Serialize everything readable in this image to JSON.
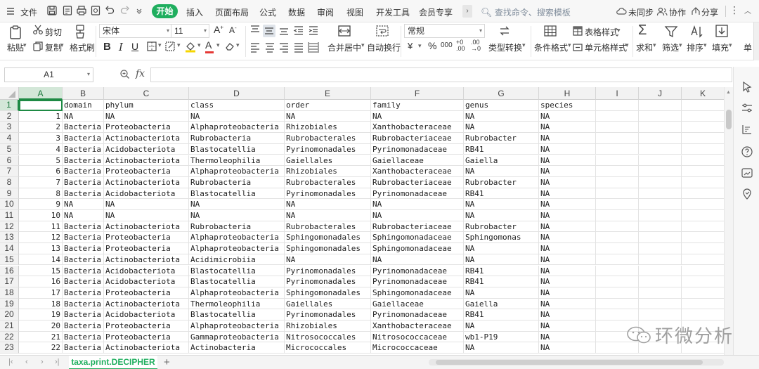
{
  "menubar": {
    "file_label": "文件",
    "tabs": [
      "开始",
      "插入",
      "页面布局",
      "公式",
      "数据",
      "审阅",
      "视图",
      "开发工具",
      "会员专享"
    ],
    "search_placeholder": "查找命令、搜索模板",
    "sync_label": "未同步",
    "collab_label": "协作",
    "share_label": "分享"
  },
  "ribbon": {
    "paste_label": "粘贴",
    "cut_label": "剪切",
    "copy_label": "复制",
    "format_painter_label": "格式刷",
    "font_name": "宋体",
    "font_size": "11",
    "merge_center_label": "合并居中",
    "wrap_text_label": "自动换行",
    "number_format": "常规",
    "type_convert_label": "类型转换",
    "conditional_format_label": "条件格式",
    "table_style_label": "表格样式",
    "cell_style_label": "单元格样式",
    "sum_label": "求和",
    "filter_label": "筛选",
    "sort_label": "排序",
    "fill_label": "填充",
    "more_label": "单",
    "percent_symbol": "%",
    "thousands_symbol": "000",
    "currency_symbol": "¥",
    "increase_decimal": "+0 .00",
    "decrease_decimal": ".00 →0"
  },
  "formulabar": {
    "namebox_value": "A1",
    "fx_label": "fx",
    "formula_value": ""
  },
  "grid": {
    "columns": [
      "A",
      "B",
      "C",
      "D",
      "E",
      "F",
      "G",
      "H",
      "I",
      "J",
      "K"
    ],
    "selected_column": "A",
    "selected_row": "1",
    "rows": [
      {
        "n": "1",
        "a": "",
        "b": "domain",
        "c": "phylum",
        "d": "class",
        "e": "order",
        "f": "family",
        "g": "genus",
        "h": "species"
      },
      {
        "n": "2",
        "a": "1",
        "b": "NA",
        "c": "NA",
        "d": "NA",
        "e": "NA",
        "f": "NA",
        "g": "NA",
        "h": "NA"
      },
      {
        "n": "3",
        "a": "2",
        "b": "Bacteria",
        "c": "Proteobacteria",
        "d": "Alphaproteobacteria",
        "e": "Rhizobiales",
        "f": "Xanthobacteraceae",
        "g": "NA",
        "h": "NA"
      },
      {
        "n": "4",
        "a": "3",
        "b": "Bacteria",
        "c": "Actinobacteriota",
        "d": "Rubrobacteria",
        "e": "Rubrobacterales",
        "f": "Rubrobacteriaceae",
        "g": "Rubrobacter",
        "h": "NA"
      },
      {
        "n": "5",
        "a": "4",
        "b": "Bacteria",
        "c": "Acidobacteriota",
        "d": "Blastocatellia",
        "e": "Pyrinomonadales",
        "f": "Pyrinomonadaceae",
        "g": "RB41",
        "h": "NA"
      },
      {
        "n": "6",
        "a": "5",
        "b": "Bacteria",
        "c": "Actinobacteriota",
        "d": "Thermoleophilia",
        "e": "Gaiellales",
        "f": "Gaiellaceae",
        "g": "Gaiella",
        "h": "NA"
      },
      {
        "n": "7",
        "a": "6",
        "b": "Bacteria",
        "c": "Proteobacteria",
        "d": "Alphaproteobacteria",
        "e": "Rhizobiales",
        "f": "Xanthobacteraceae",
        "g": "NA",
        "h": "NA"
      },
      {
        "n": "8",
        "a": "7",
        "b": "Bacteria",
        "c": "Actinobacteriota",
        "d": "Rubrobacteria",
        "e": "Rubrobacterales",
        "f": "Rubrobacteriaceae",
        "g": "Rubrobacter",
        "h": "NA"
      },
      {
        "n": "9",
        "a": "8",
        "b": "Bacteria",
        "c": "Acidobacteriota",
        "d": "Blastocatellia",
        "e": "Pyrinomonadales",
        "f": "Pyrinomonadaceae",
        "g": "RB41",
        "h": "NA"
      },
      {
        "n": "10",
        "a": "9",
        "b": "NA",
        "c": "NA",
        "d": "NA",
        "e": "NA",
        "f": "NA",
        "g": "NA",
        "h": "NA"
      },
      {
        "n": "11",
        "a": "10",
        "b": "NA",
        "c": "NA",
        "d": "NA",
        "e": "NA",
        "f": "NA",
        "g": "NA",
        "h": "NA"
      },
      {
        "n": "12",
        "a": "11",
        "b": "Bacteria",
        "c": "Actinobacteriota",
        "d": "Rubrobacteria",
        "e": "Rubrobacterales",
        "f": "Rubrobacteriaceae",
        "g": "Rubrobacter",
        "h": "NA"
      },
      {
        "n": "13",
        "a": "12",
        "b": "Bacteria",
        "c": "Proteobacteria",
        "d": "Alphaproteobacteria",
        "e": "Sphingomonadales",
        "f": "Sphingomonadaceae",
        "g": "Sphingomonas",
        "h": "NA"
      },
      {
        "n": "14",
        "a": "13",
        "b": "Bacteria",
        "c": "Proteobacteria",
        "d": "Alphaproteobacteria",
        "e": "Sphingomonadales",
        "f": "Sphingomonadaceae",
        "g": "NA",
        "h": "NA"
      },
      {
        "n": "15",
        "a": "14",
        "b": "Bacteria",
        "c": "Actinobacteriota",
        "d": "Acidimicrobiia",
        "e": "NA",
        "f": "NA",
        "g": "NA",
        "h": "NA"
      },
      {
        "n": "16",
        "a": "15",
        "b": "Bacteria",
        "c": "Acidobacteriota",
        "d": "Blastocatellia",
        "e": "Pyrinomonadales",
        "f": "Pyrinomonadaceae",
        "g": "RB41",
        "h": "NA"
      },
      {
        "n": "17",
        "a": "16",
        "b": "Bacteria",
        "c": "Acidobacteriota",
        "d": "Blastocatellia",
        "e": "Pyrinomonadales",
        "f": "Pyrinomonadaceae",
        "g": "RB41",
        "h": "NA"
      },
      {
        "n": "18",
        "a": "17",
        "b": "Bacteria",
        "c": "Proteobacteria",
        "d": "Alphaproteobacteria",
        "e": "Sphingomonadales",
        "f": "Sphingomonadaceae",
        "g": "NA",
        "h": "NA"
      },
      {
        "n": "19",
        "a": "18",
        "b": "Bacteria",
        "c": "Actinobacteriota",
        "d": "Thermoleophilia",
        "e": "Gaiellales",
        "f": "Gaiellaceae",
        "g": "Gaiella",
        "h": "NA"
      },
      {
        "n": "20",
        "a": "19",
        "b": "Bacteria",
        "c": "Acidobacteriota",
        "d": "Blastocatellia",
        "e": "Pyrinomonadales",
        "f": "Pyrinomonadaceae",
        "g": "RB41",
        "h": "NA"
      },
      {
        "n": "21",
        "a": "20",
        "b": "Bacteria",
        "c": "Proteobacteria",
        "d": "Alphaproteobacteria",
        "e": "Rhizobiales",
        "f": "Xanthobacteraceae",
        "g": "NA",
        "h": "NA"
      },
      {
        "n": "22",
        "a": "21",
        "b": "Bacteria",
        "c": "Proteobacteria",
        "d": "Gammaproteobacteria",
        "e": "Nitrosococcales",
        "f": "Nitrosococcaceae",
        "g": "wb1-P19",
        "h": "NA"
      },
      {
        "n": "23",
        "a": "22",
        "b": "Bacteria",
        "c": "Actinobacteriota",
        "d": "Actinobacteria",
        "e": "Micrococcales",
        "f": "Micrococcaceae",
        "g": "NA",
        "h": "NA"
      }
    ]
  },
  "sheets": {
    "active_sheet": "taxa.print.DECIPHER",
    "add_label": "+"
  },
  "watermark": {
    "text": "环微分析"
  },
  "colors": {
    "accent": "#1fae5e",
    "selection": "#1e8a44",
    "header_bg": "#f2f2f2"
  }
}
